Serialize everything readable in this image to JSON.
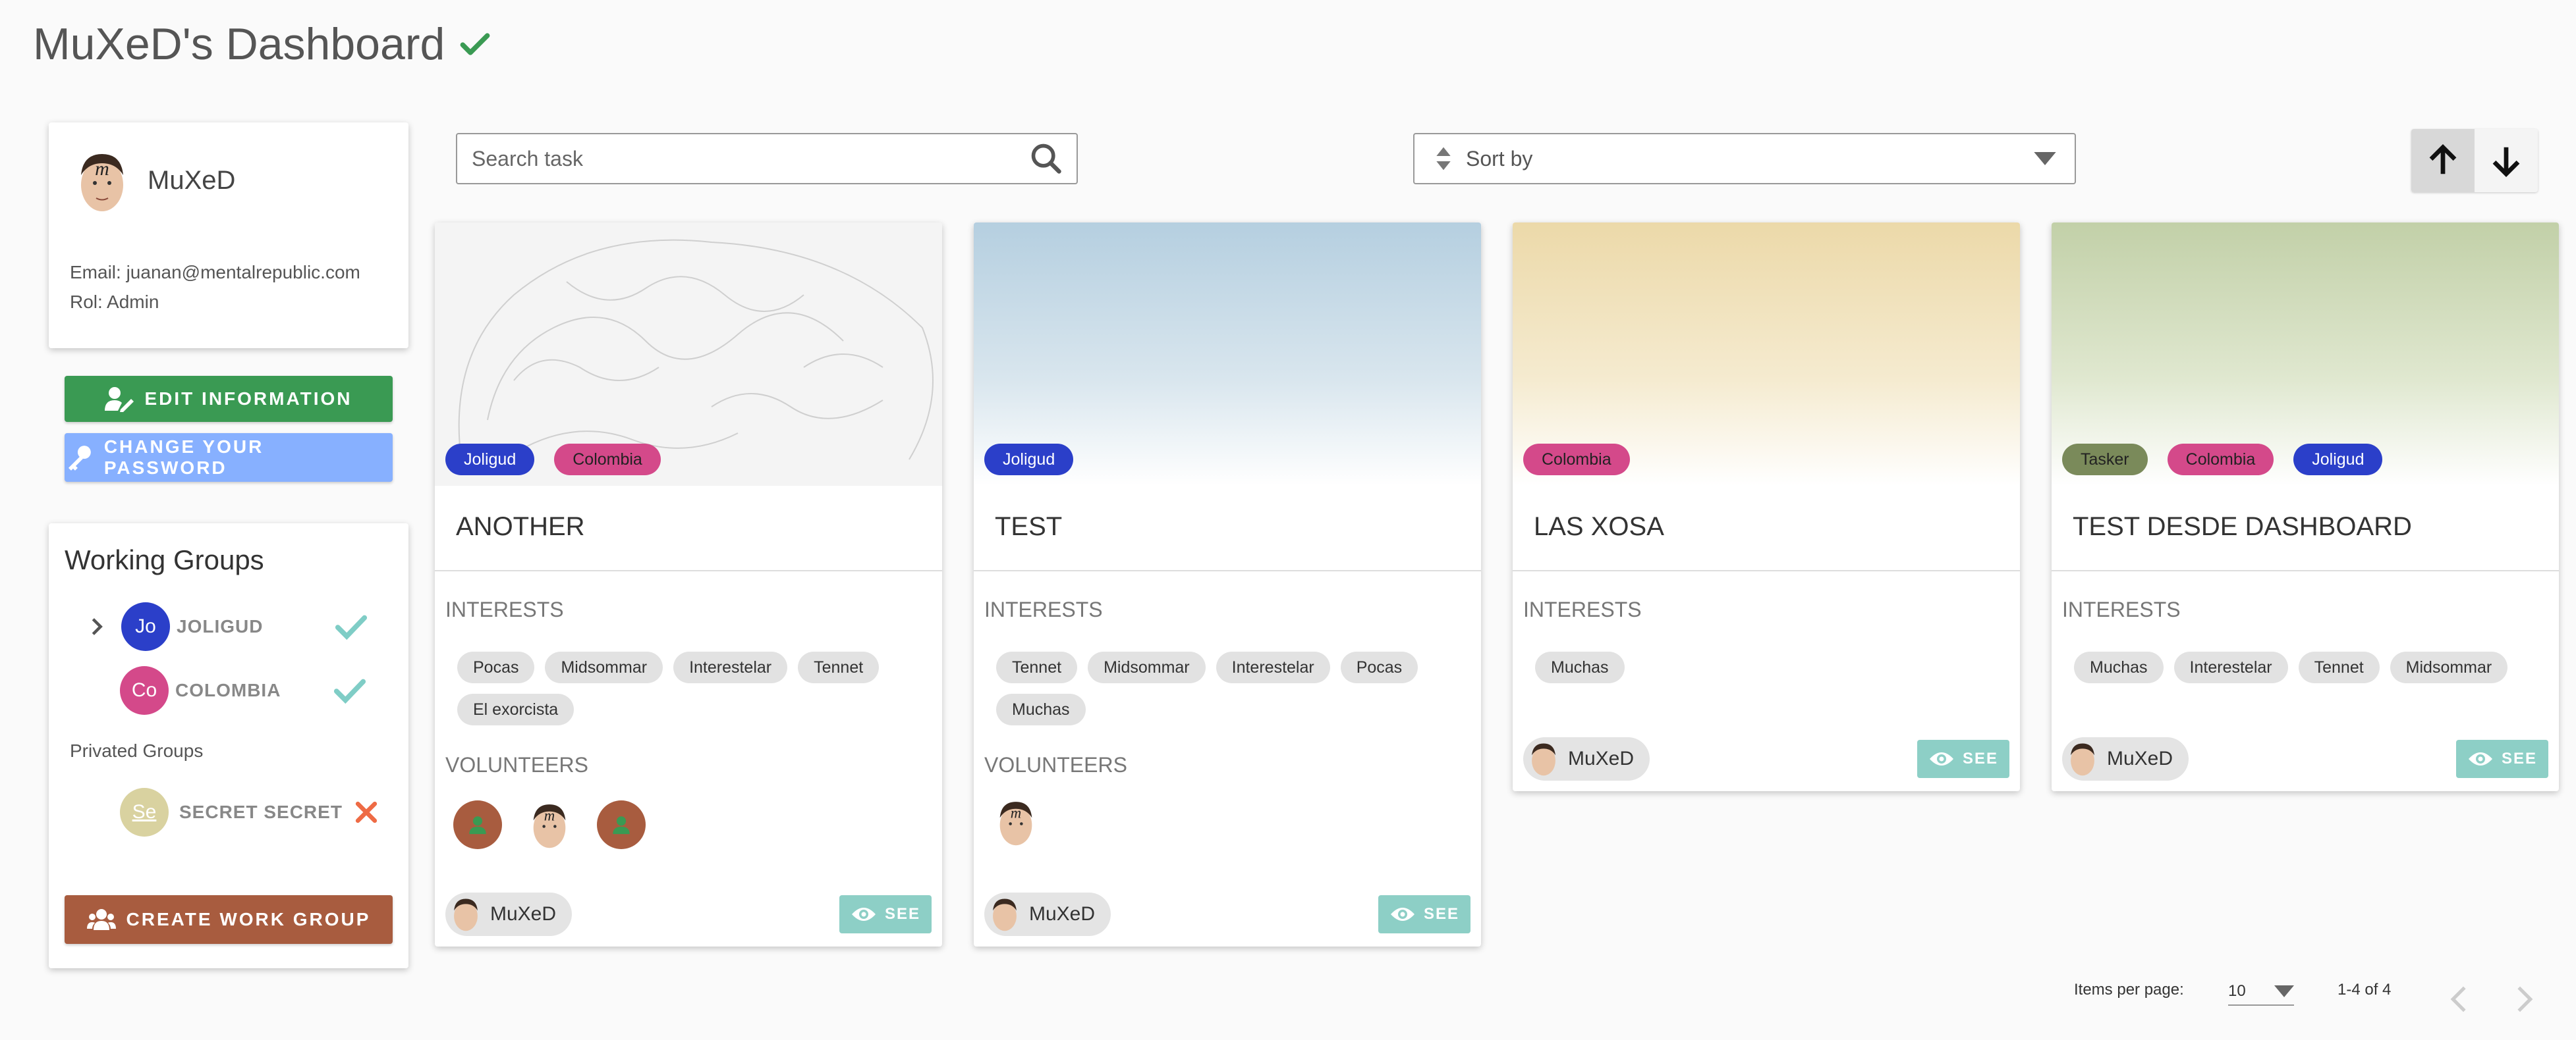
{
  "page": {
    "title": "MuXeD's Dashboard"
  },
  "profile": {
    "name": "MuXeD",
    "email_line": "Email: juanan@mentalrepublic.com",
    "role_line": "Rol: Admin"
  },
  "buttons": {
    "edit": "EDIT INFORMATION",
    "change_password": "CHANGE YOUR PASSWORD",
    "create_group": "CREATE WORK GROUP"
  },
  "groups": {
    "title": "Working Groups",
    "items": [
      {
        "initials": "Jo",
        "name": "JOLIGUD",
        "color": "#2b3fc9"
      },
      {
        "initials": "Co",
        "name": "COLOMBIA",
        "color": "#d4498a"
      }
    ],
    "private_title": "Privated Groups",
    "private_items": [
      {
        "initials": "Se",
        "name": "SECRET SECRET",
        "color": "#d9d2a0"
      }
    ]
  },
  "search": {
    "placeholder": "Search task"
  },
  "sort": {
    "label": "Sort by"
  },
  "tasks": [
    {
      "name": "ANOTHER",
      "tags": [
        {
          "label": "Joligud",
          "color": "#2b3fc9"
        },
        {
          "label": "Colombia",
          "color": "#d4498a"
        }
      ],
      "interests_label": "INTERESTS",
      "interests": [
        "Pocas",
        "Midsommar",
        "Interestelar",
        "Tennet",
        "El exorcista"
      ],
      "volunteers_label": "VOLUNTEERS",
      "owner": "MuXeD",
      "see": "SEE"
    },
    {
      "name": "TEST",
      "tags": [
        {
          "label": "Joligud",
          "color": "#2b3fc9"
        }
      ],
      "interests_label": "INTERESTS",
      "interests": [
        "Tennet",
        "Midsommar",
        "Interestelar",
        "Pocas",
        "Muchas"
      ],
      "volunteers_label": "VOLUNTEERS",
      "owner": "MuXeD",
      "see": "SEE"
    },
    {
      "name": "LAS XOSA",
      "tags": [
        {
          "label": "Colombia",
          "color": "#d4498a"
        }
      ],
      "interests_label": "INTERESTS",
      "interests": [
        "Muchas"
      ],
      "owner": "MuXeD",
      "see": "SEE"
    },
    {
      "name": "TEST DESDE DASHBOARD",
      "tags": [
        {
          "label": "Tasker",
          "color": "#7a8a5a"
        },
        {
          "label": "Colombia",
          "color": "#d4498a"
        },
        {
          "label": "Joligud",
          "color": "#2b3fc9"
        }
      ],
      "interests_label": "INTERESTS",
      "interests": [
        "Muchas",
        "Interestelar",
        "Tennet",
        "Midsommar"
      ],
      "owner": "MuXeD",
      "see": "SEE"
    }
  ],
  "pagination": {
    "items_per_page_label": "Items per page:",
    "items_per_page": "10",
    "range": "1-4 of 4"
  }
}
